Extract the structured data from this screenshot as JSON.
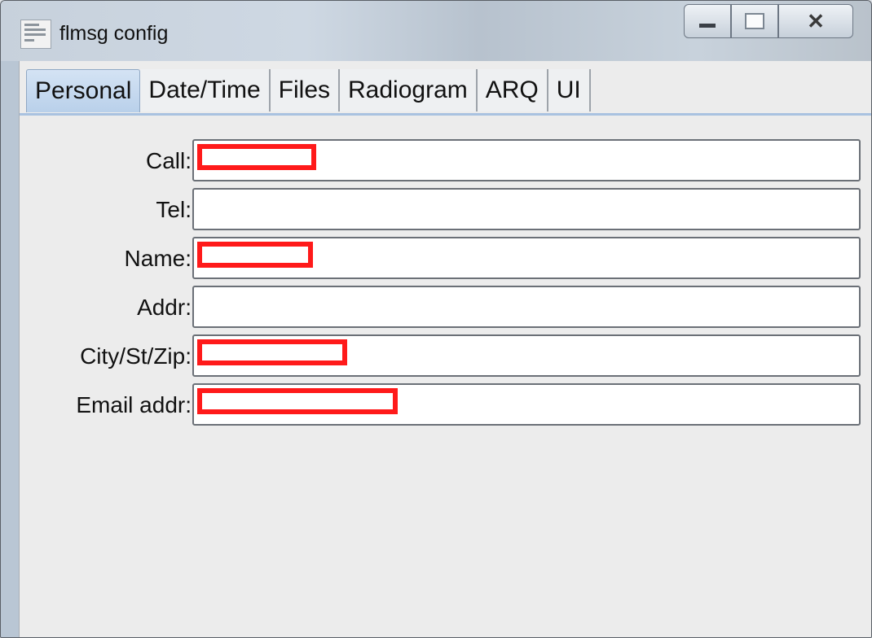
{
  "window": {
    "title": "flmsg config"
  },
  "tabs": [
    {
      "label": "Personal",
      "active": true
    },
    {
      "label": "Date/Time",
      "active": false
    },
    {
      "label": "Files",
      "active": false
    },
    {
      "label": "Radiogram",
      "active": false
    },
    {
      "label": "ARQ",
      "active": false
    },
    {
      "label": "UI",
      "active": false
    }
  ],
  "form": {
    "call_label": "Call:",
    "call_value": "",
    "tel_label": "Tel:",
    "tel_value": "",
    "name_label": "Name:",
    "name_value": "",
    "addr_label": "Addr:",
    "addr_value": "",
    "city_label": "City/St/Zip:",
    "city_value": "",
    "email_label": "Email addr:",
    "email_value": ""
  },
  "colors": {
    "redaction": "#ff1a1a",
    "active_tab": "#c4d8ef"
  }
}
